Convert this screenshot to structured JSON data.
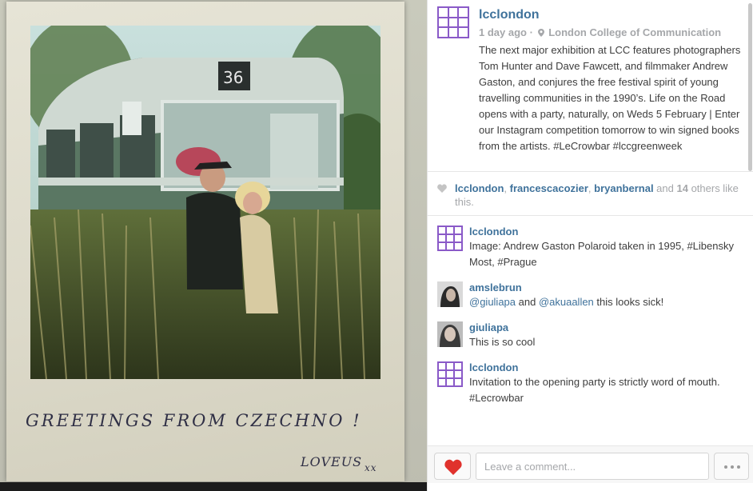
{
  "photo": {
    "bus_route": "36",
    "handwriting_line1": "GREETINGS FROM CZECHNO !",
    "handwriting_line2": "LOVEUS",
    "handwriting_kisses": "xx"
  },
  "post": {
    "username": "lcclondon",
    "time": "1 day ago",
    "separator": "·",
    "location": "London College of Communication",
    "caption": "The next major exhibition at LCC features photographers Tom Hunter and Dave Fawcett, and filmmaker Andrew Gaston, and conjures the free festival spirit of young travelling communities in the 1990’s. Life on the Road opens with a party, naturally, on Weds 5 February | Enter our Instagram competition tomorrow to win signed books from the artists. #LeCrowbar #lccgreenweek"
  },
  "likes": {
    "users": [
      "lcclondon",
      "francescacozier",
      "bryanbernal"
    ],
    "sep1": ", ",
    "sep2": ", ",
    "and_text": " and ",
    "others_count": "14",
    "others_text": " others like this."
  },
  "comments": [
    {
      "user": "lcclondon",
      "text": "Image: Andrew Gaston Polaroid taken in 1995, #Libensky Most, #Prague"
    },
    {
      "user": "amslebrun",
      "mention1": "@giuliapa",
      "mid": " and ",
      "mention2": "@akuaallen",
      "rest": " this looks sick!"
    },
    {
      "user": "giuliapa",
      "text": "This is so cool"
    },
    {
      "user": "lcclondon",
      "text": "Invitation to the opening party is strictly word of mouth. #Lecrowbar"
    }
  ],
  "footer": {
    "comment_placeholder": "Leave a comment..."
  },
  "colors": {
    "link": "#3f729b",
    "like_red": "#e0322d",
    "avatar_purple": "#8a5ac8"
  },
  "icons": [
    "heart-icon",
    "location-pin-icon",
    "more-dots-icon"
  ]
}
